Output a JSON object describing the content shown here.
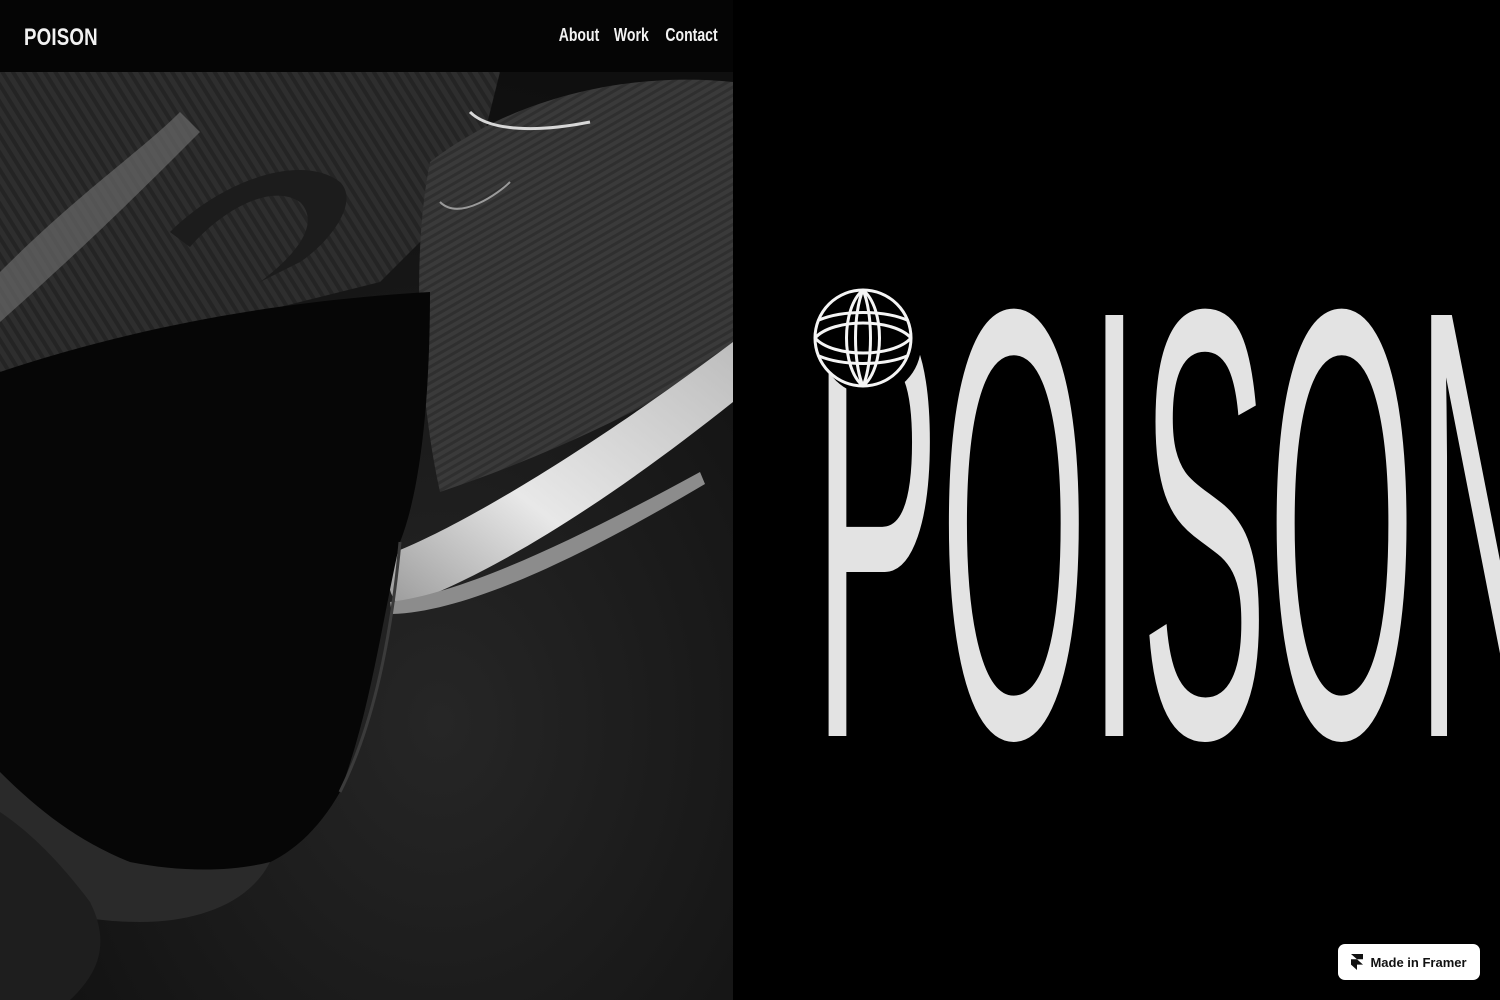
{
  "header": {
    "logo": "POISON",
    "nav": [
      {
        "label": "About"
      },
      {
        "label": "Work"
      },
      {
        "label": "Contact"
      }
    ]
  },
  "hero": {
    "word": "POISON",
    "text_color": "#e3e3e3",
    "icon": "globe-icon"
  },
  "badge": {
    "label": "Made in Framer",
    "icon": "framer-logo-icon"
  },
  "colors": {
    "background": "#000000",
    "text": "#f2f2f2",
    "badge_bg": "#ffffff"
  }
}
